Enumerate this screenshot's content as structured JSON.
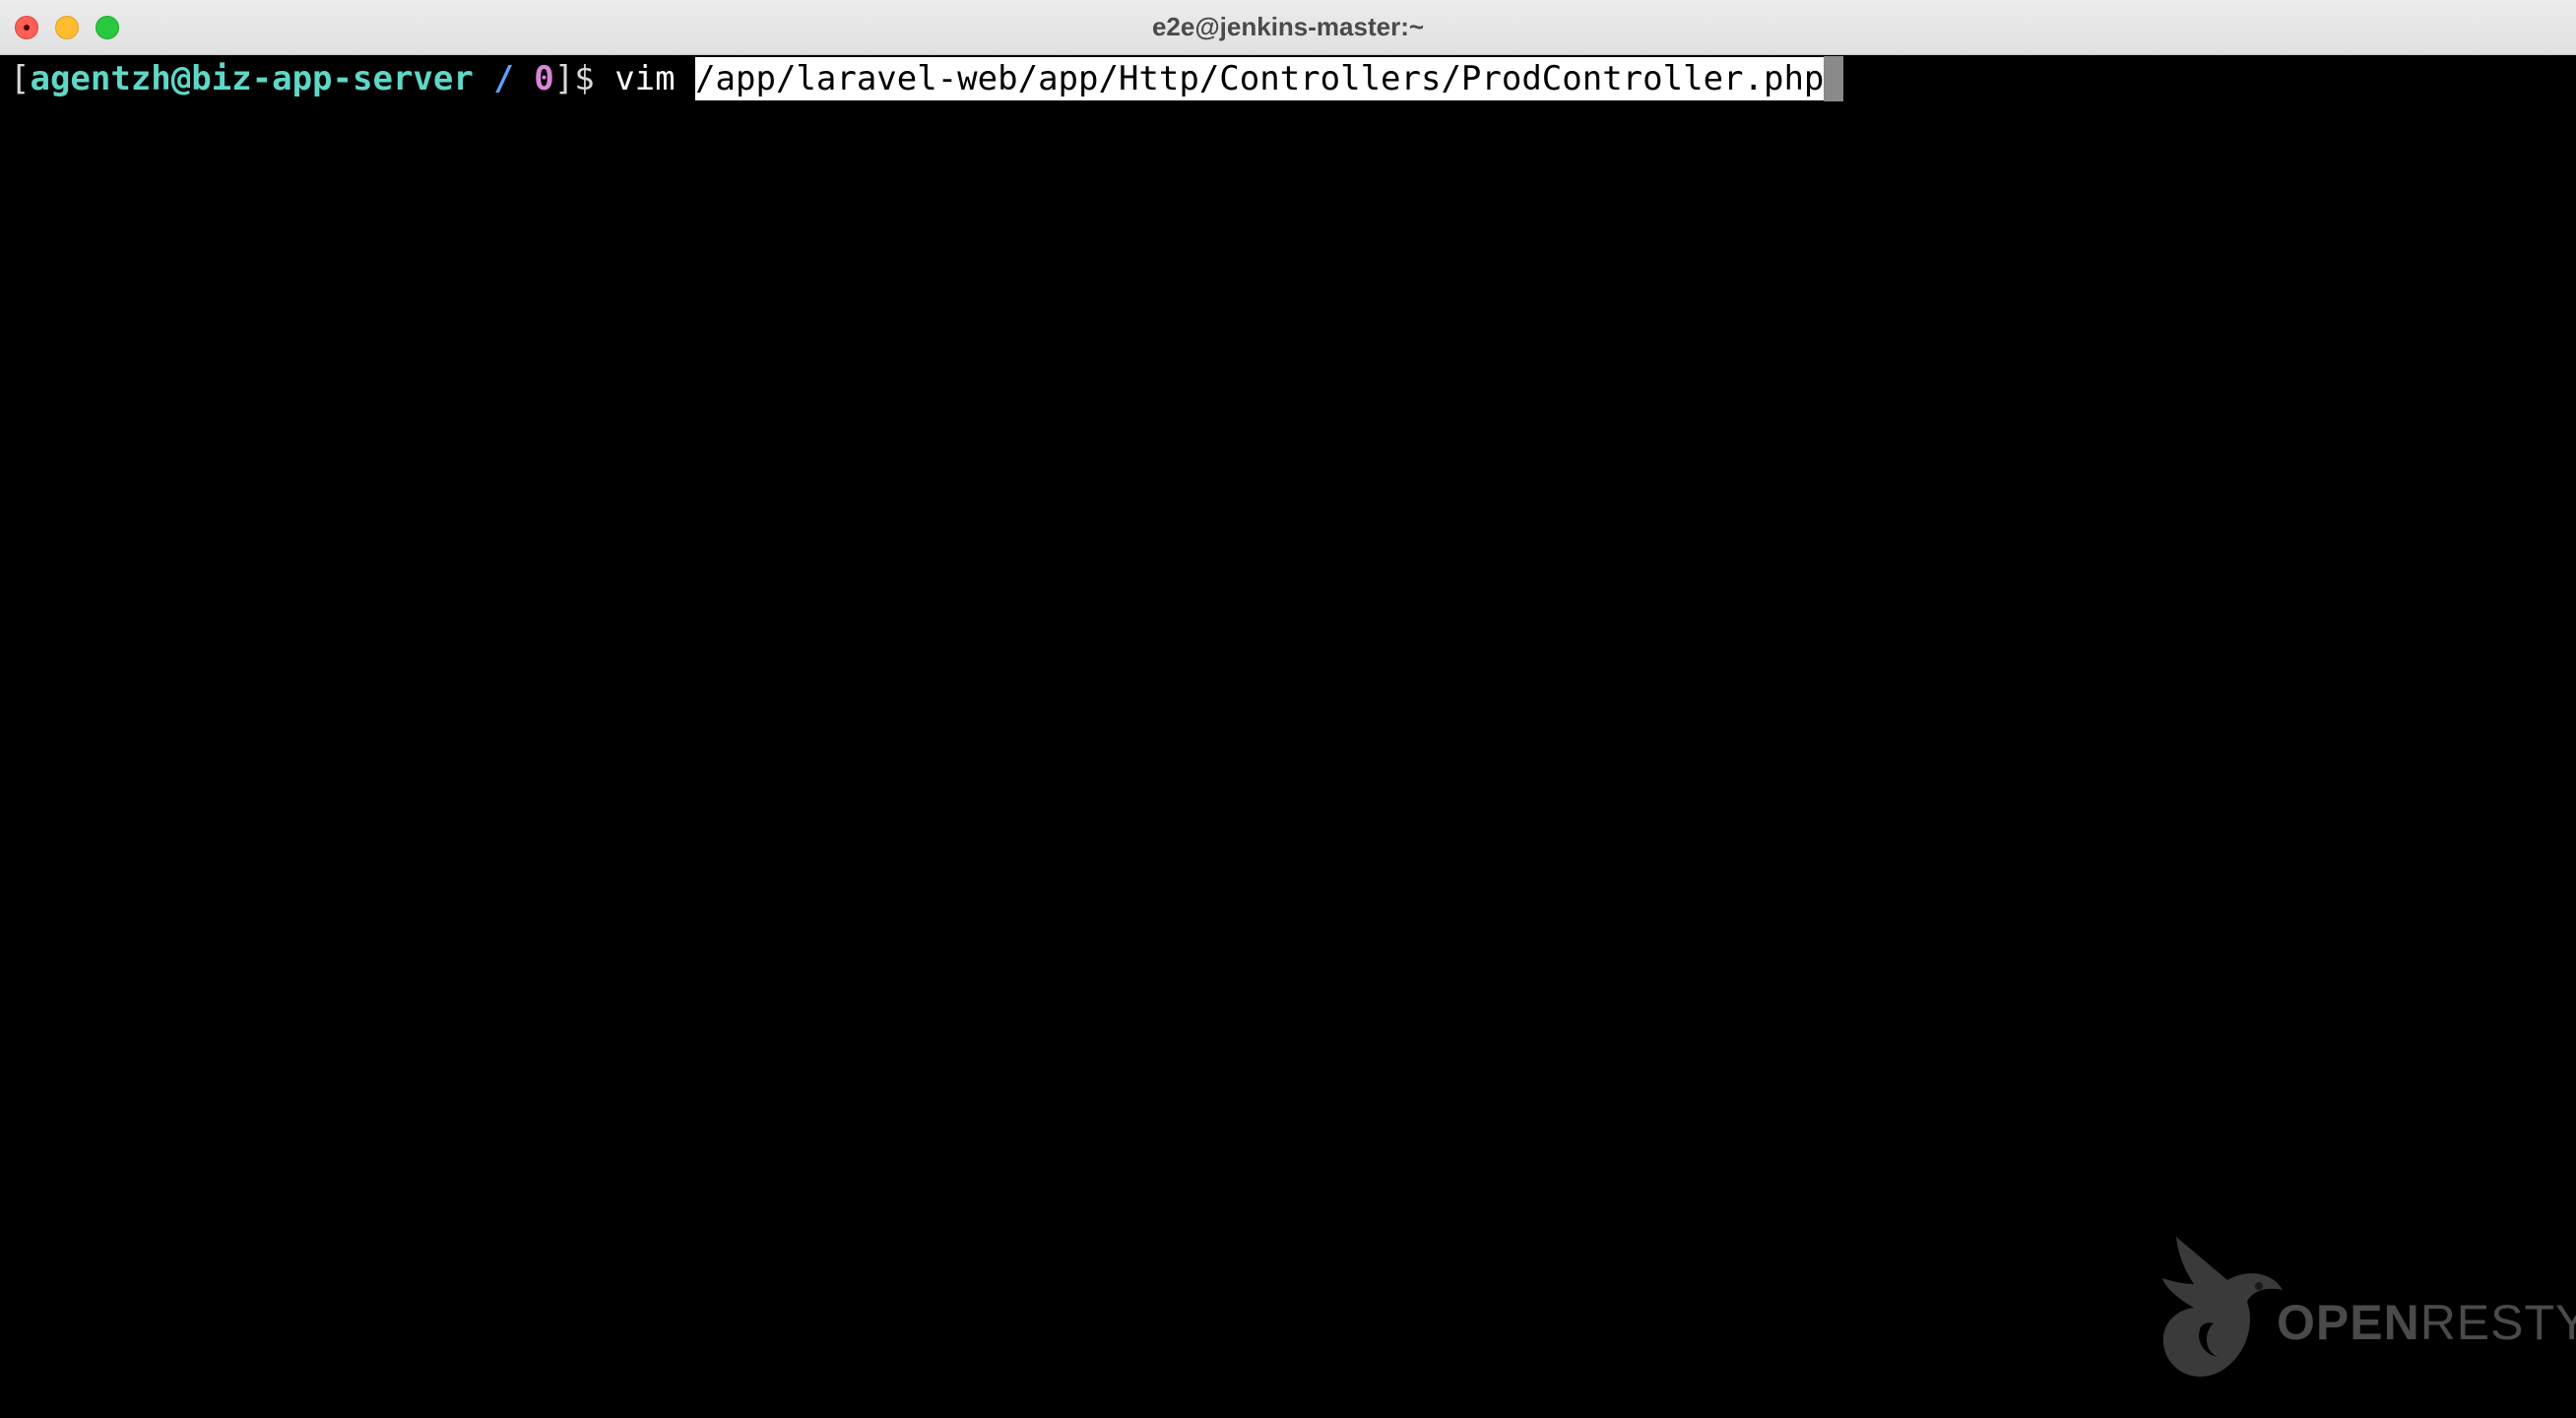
{
  "window": {
    "title": "e2e@jenkins-master:~"
  },
  "terminal": {
    "prompt": {
      "open_bracket": "[",
      "user_host": "agentzh@biz-app-server",
      "space1": " ",
      "cwd": "/",
      "space2": " ",
      "exit_code": "0",
      "close_dollar": "]$"
    },
    "command": {
      "program": " vim ",
      "argument": "/app/laravel-web/app/Http/Controllers/ProdController.php"
    },
    "colors": {
      "user_host": "#5fd7c7",
      "cwd": "#5f9fff",
      "exit_code": "#d787d7",
      "selection_bg": "#ffffff"
    }
  },
  "watermark": {
    "icon": "openresty-bird-icon",
    "text_part1": "OPEN",
    "text_part2": "RESTY"
  }
}
